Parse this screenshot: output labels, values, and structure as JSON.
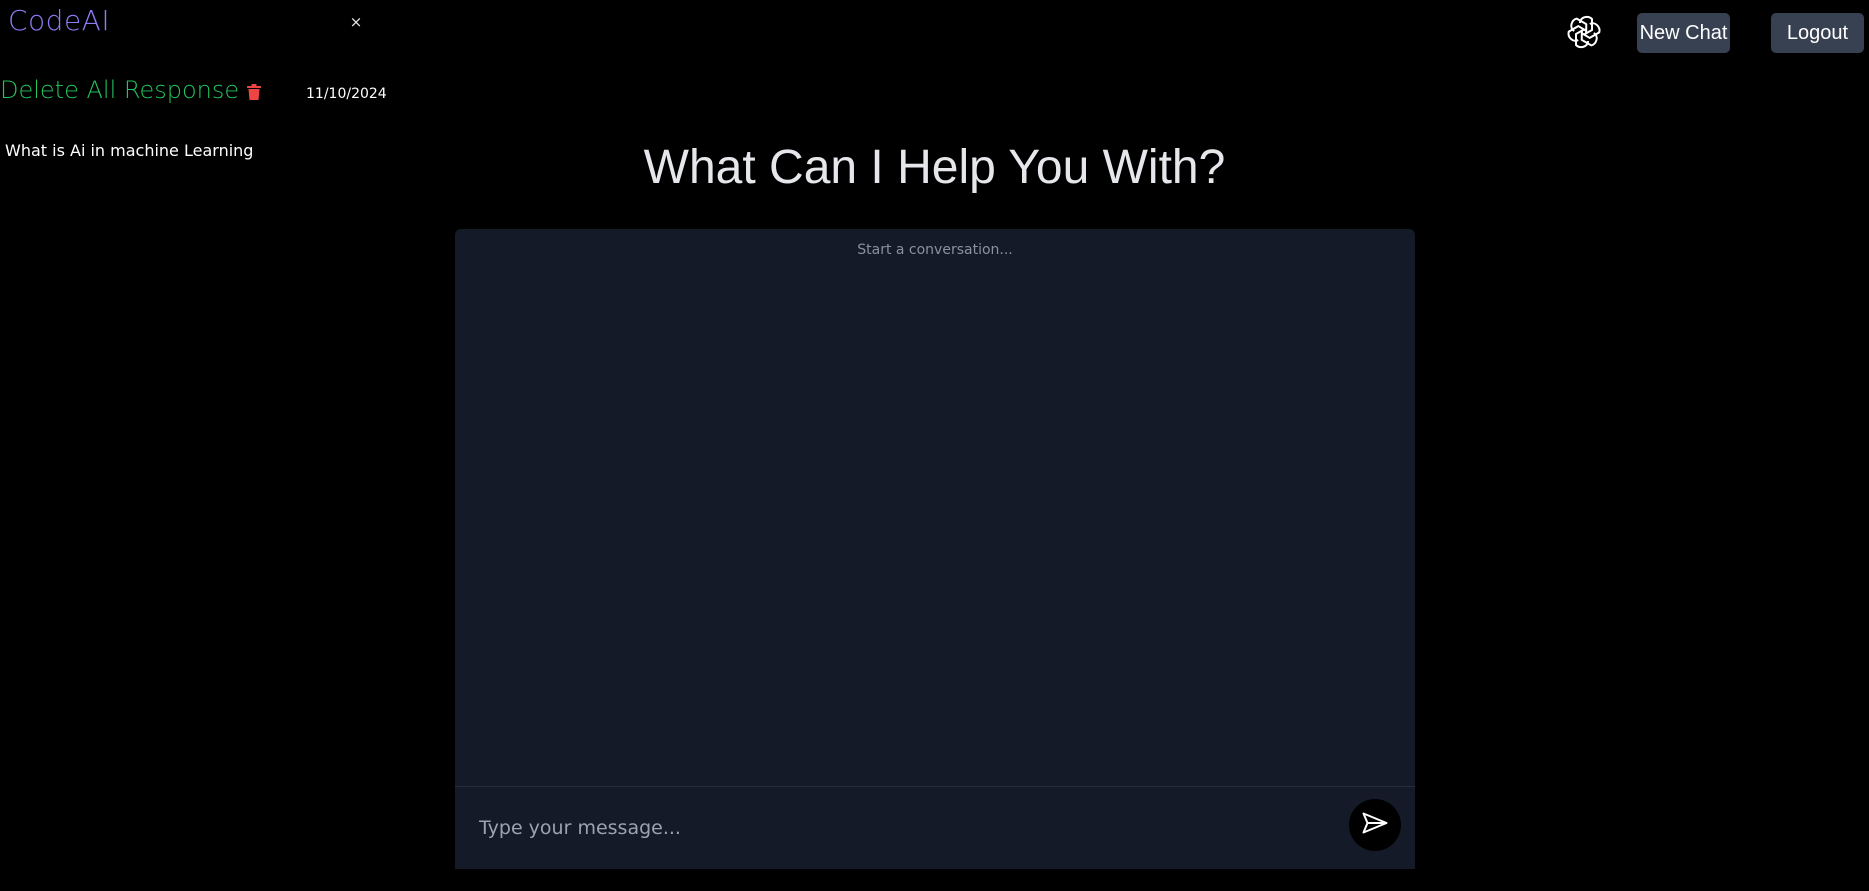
{
  "app": {
    "brand": "CodeAI",
    "close_symbol": "×"
  },
  "sidebar": {
    "delete_all_label": "Delete All Response",
    "delete_icon": "trash-icon",
    "date": "11/10/2024",
    "history": [
      {
        "label": "What is Ai in machine Learning"
      }
    ]
  },
  "header": {
    "logo_icon": "openai-logo-icon",
    "new_chat_label": "New Chat",
    "logout_label": "Logout"
  },
  "main": {
    "heading": "What Can I Help You With?",
    "empty_state": "Start a conversation...",
    "input_placeholder": "Type your message...",
    "send_icon": "send-icon"
  },
  "colors": {
    "background": "#000000",
    "brand": "#8b7cf6",
    "delete_all": "#22c55e",
    "trash": "#ef4444",
    "panel": "#141a28",
    "button": "#374151"
  }
}
